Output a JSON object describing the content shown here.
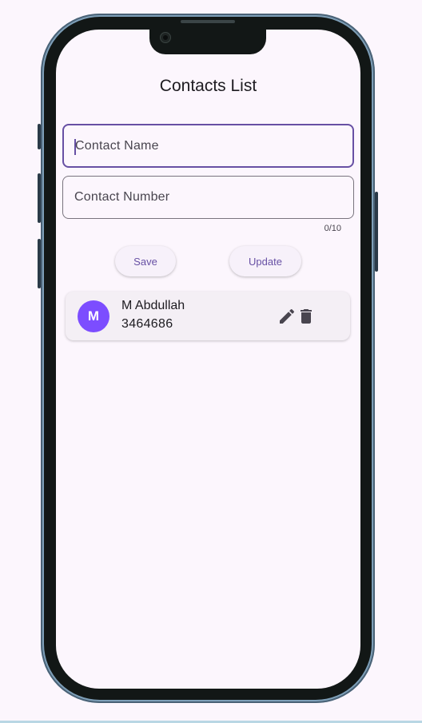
{
  "app": {
    "title": "Contacts List"
  },
  "form": {
    "name_placeholder": "Contact Name",
    "number_placeholder": "Contact Number",
    "number_counter": "0/10"
  },
  "actions": {
    "save_label": "Save",
    "update_label": "Update"
  },
  "contacts": [
    {
      "initial": "M",
      "name": "M Abdullah",
      "number": "3464686"
    }
  ],
  "icons": {
    "edit": "edit-icon",
    "delete": "delete-icon"
  },
  "colors": {
    "primary": "#6750a4",
    "avatar": "#7c4dff",
    "background": "#fcf6fd",
    "card": "#f4eff5"
  }
}
